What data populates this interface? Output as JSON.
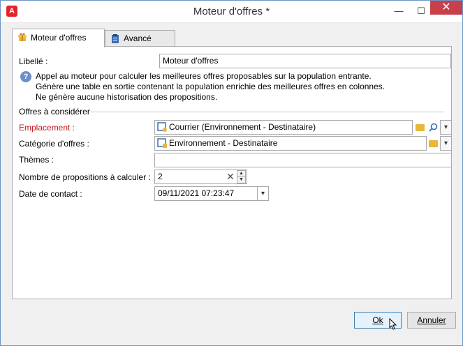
{
  "window": {
    "title": "Moteur d'offres *",
    "app_icon_letter": "A"
  },
  "titlebar_buttons": {
    "minimize": "—",
    "maximize": "☐",
    "close": "✕"
  },
  "tabs": [
    {
      "label": "Moteur d'offres",
      "active": true
    },
    {
      "label": "Avancé",
      "active": false
    }
  ],
  "form": {
    "libelle_label": "Libellé :",
    "libelle_value": "Moteur d'offres",
    "description": [
      "Appel au moteur pour calculer les meilleures offres proposables sur la population entrante.",
      "Génère une table en sortie contenant la population enrichie des meilleures offres en colonnes.",
      "Ne génère aucune historisation des propositions."
    ],
    "section_title": "Offres à considérer",
    "emplacement_label": "Emplacement :",
    "emplacement_value": "Courrier (Environnement - Destinataire)",
    "categorie_label": "Catégorie d'offres :",
    "categorie_value": "Environnement - Destinataire",
    "themes_label": "Thèmes :",
    "themes_value": "",
    "nb_label": "Nombre de propositions à calculer :",
    "nb_value": "2",
    "date_label": "Date de contact :",
    "date_value": "09/11/2021 07:23:47"
  },
  "buttons": {
    "ok": "Ok",
    "cancel": "Annuler"
  },
  "colors": {
    "required_label": "#c5161d",
    "accent": "#3c7fb1"
  }
}
